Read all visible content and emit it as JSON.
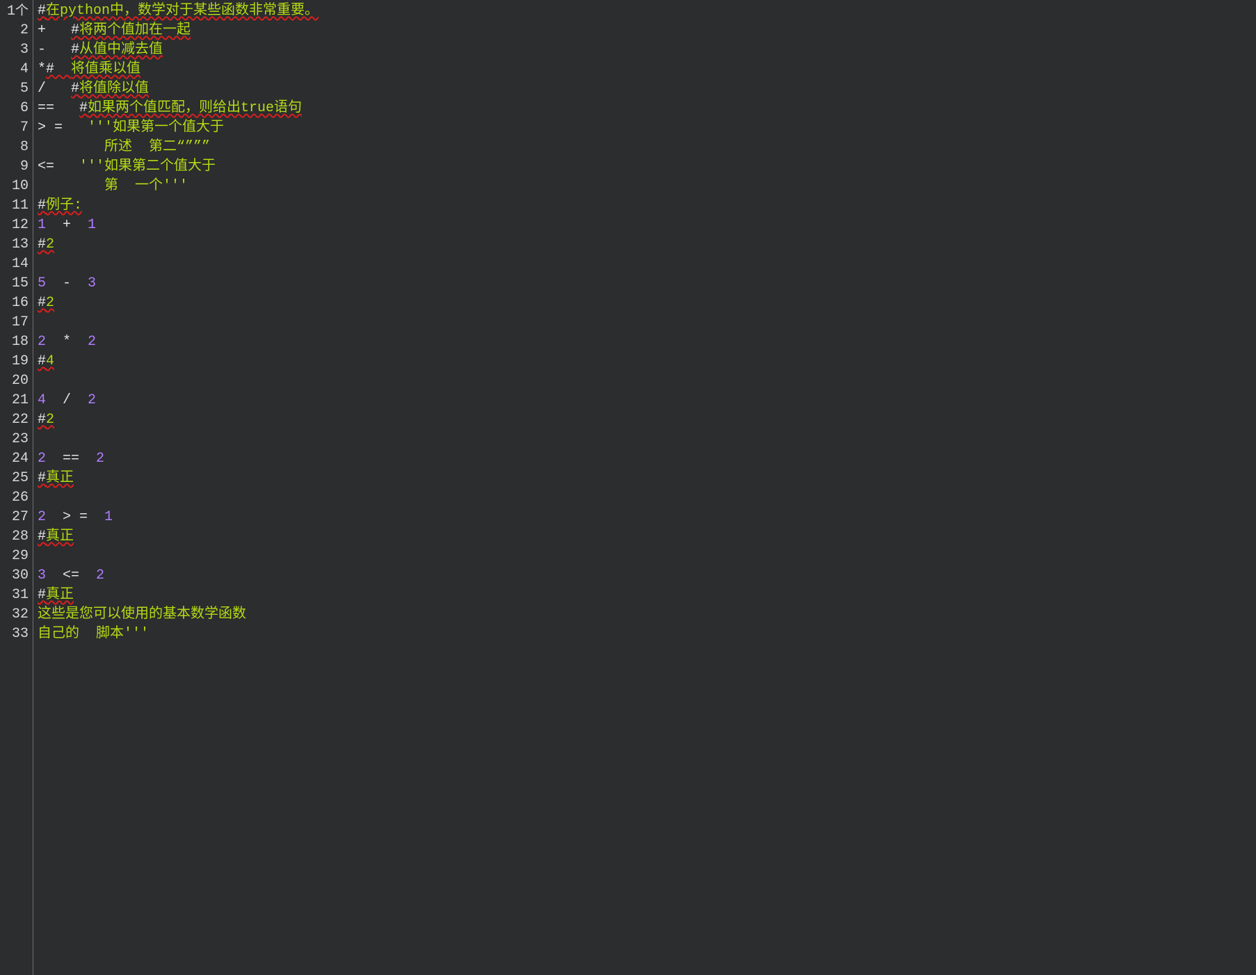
{
  "gutter": {
    "first_suffix": "个",
    "count": 33
  },
  "code": {
    "lines": [
      {
        "segments": [
          {
            "cls": "hash lint",
            "t": "#"
          },
          {
            "cls": "tok-comment lint",
            "t": "在python中，数学对于某些函数非常重要。"
          }
        ]
      },
      {
        "segments": [
          {
            "cls": "tok-op",
            "t": "+   "
          },
          {
            "cls": "hash lint",
            "t": "#"
          },
          {
            "cls": "tok-comment lint",
            "t": "将两个值加在一起"
          }
        ]
      },
      {
        "segments": [
          {
            "cls": "tok-op",
            "t": "-   "
          },
          {
            "cls": "hash lint",
            "t": "#"
          },
          {
            "cls": "tok-comment lint",
            "t": "从值中减去值"
          }
        ]
      },
      {
        "segments": [
          {
            "cls": "tok-op",
            "t": "*"
          },
          {
            "cls": "hash lint",
            "t": "#  "
          },
          {
            "cls": "tok-comment lint",
            "t": "将值乘以值"
          }
        ]
      },
      {
        "segments": [
          {
            "cls": "tok-op",
            "t": "/   "
          },
          {
            "cls": "hash lint",
            "t": "#"
          },
          {
            "cls": "tok-comment lint",
            "t": "将值除以值"
          }
        ]
      },
      {
        "segments": [
          {
            "cls": "tok-op",
            "t": "==   "
          },
          {
            "cls": "hash lint",
            "t": "#"
          },
          {
            "cls": "tok-comment lint",
            "t": "如果两个值匹配，则给出true语句"
          }
        ]
      },
      {
        "segments": [
          {
            "cls": "tok-op",
            "t": "> =   "
          },
          {
            "cls": "tok-string",
            "t": "'''如果第一个值大于"
          }
        ]
      },
      {
        "segments": [
          {
            "cls": "tok-string",
            "t": "        所述  第二“”””"
          }
        ]
      },
      {
        "segments": [
          {
            "cls": "tok-op",
            "t": "<=   "
          },
          {
            "cls": "tok-string",
            "t": "'''如果第二个值大于"
          }
        ]
      },
      {
        "segments": [
          {
            "cls": "tok-string",
            "t": "        第  一个'''"
          }
        ]
      },
      {
        "segments": [
          {
            "cls": "hash lint",
            "t": "#"
          },
          {
            "cls": "tok-comment lint",
            "t": "例子:"
          }
        ]
      },
      {
        "segments": [
          {
            "cls": "tok-number",
            "t": "1"
          },
          {
            "cls": "tok-op",
            "t": "  +  "
          },
          {
            "cls": "tok-number",
            "t": "1"
          }
        ]
      },
      {
        "segments": [
          {
            "cls": "hash lint",
            "t": "#"
          },
          {
            "cls": "tok-comment lint",
            "t": "2"
          }
        ]
      },
      {
        "segments": []
      },
      {
        "segments": [
          {
            "cls": "tok-number",
            "t": "5"
          },
          {
            "cls": "tok-op",
            "t": "  -  "
          },
          {
            "cls": "tok-number",
            "t": "3"
          }
        ]
      },
      {
        "segments": [
          {
            "cls": "hash lint",
            "t": "#"
          },
          {
            "cls": "tok-comment lint",
            "t": "2"
          }
        ]
      },
      {
        "segments": []
      },
      {
        "segments": [
          {
            "cls": "tok-number",
            "t": "2"
          },
          {
            "cls": "tok-op",
            "t": "  *  "
          },
          {
            "cls": "tok-number",
            "t": "2"
          }
        ]
      },
      {
        "segments": [
          {
            "cls": "hash lint",
            "t": "#"
          },
          {
            "cls": "tok-comment lint",
            "t": "4"
          }
        ]
      },
      {
        "segments": []
      },
      {
        "segments": [
          {
            "cls": "tok-number",
            "t": "4"
          },
          {
            "cls": "tok-op",
            "t": "  /  "
          },
          {
            "cls": "tok-number",
            "t": "2"
          }
        ]
      },
      {
        "segments": [
          {
            "cls": "hash lint",
            "t": "#"
          },
          {
            "cls": "tok-comment lint",
            "t": "2"
          }
        ]
      },
      {
        "segments": []
      },
      {
        "segments": [
          {
            "cls": "tok-number",
            "t": "2"
          },
          {
            "cls": "tok-op",
            "t": "  ==  "
          },
          {
            "cls": "tok-number",
            "t": "2"
          }
        ]
      },
      {
        "segments": [
          {
            "cls": "hash lint",
            "t": "#"
          },
          {
            "cls": "tok-comment lint",
            "t": "真正"
          }
        ]
      },
      {
        "segments": []
      },
      {
        "segments": [
          {
            "cls": "tok-number",
            "t": "2"
          },
          {
            "cls": "tok-op",
            "t": "  > =  "
          },
          {
            "cls": "tok-number",
            "t": "1"
          }
        ]
      },
      {
        "segments": [
          {
            "cls": "hash lint",
            "t": "#"
          },
          {
            "cls": "tok-comment lint",
            "t": "真正"
          }
        ]
      },
      {
        "segments": []
      },
      {
        "segments": [
          {
            "cls": "tok-number",
            "t": "3"
          },
          {
            "cls": "tok-op",
            "t": "  <=  "
          },
          {
            "cls": "tok-number",
            "t": "2"
          }
        ]
      },
      {
        "segments": [
          {
            "cls": "hash lint",
            "t": "#"
          },
          {
            "cls": "tok-comment lint",
            "t": "真正"
          }
        ]
      },
      {
        "segments": [
          {
            "cls": "tok-string",
            "t": "这些是您可以使用的基本数学函数"
          }
        ]
      },
      {
        "segments": [
          {
            "cls": "tok-string",
            "t": "自己的  脚本'''"
          }
        ]
      }
    ]
  }
}
